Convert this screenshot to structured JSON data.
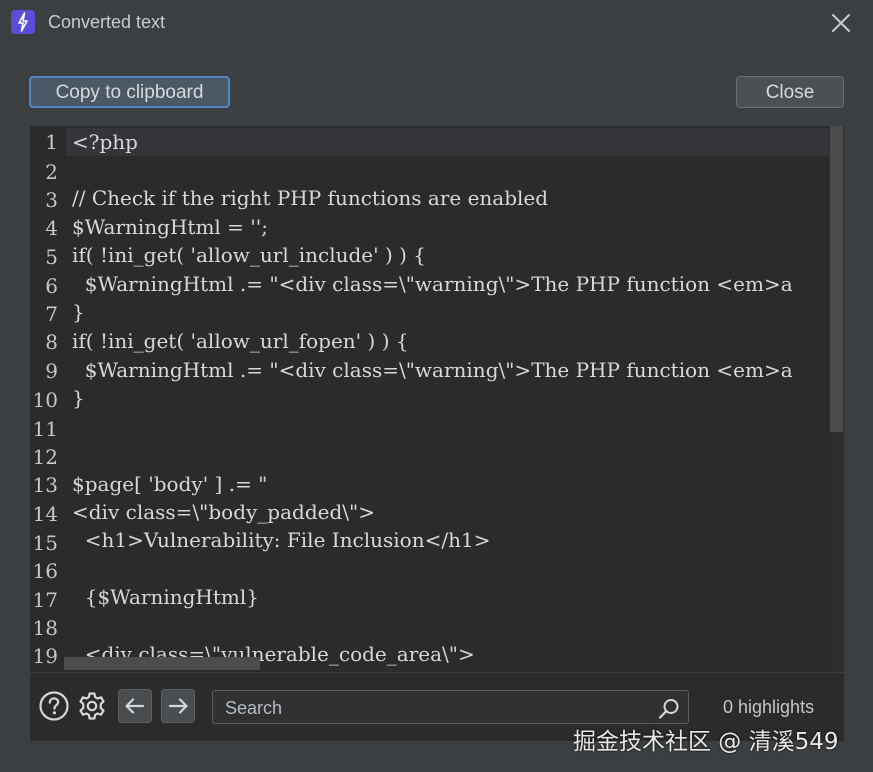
{
  "window": {
    "title": "Converted text",
    "app_icon": "lightning-icon",
    "accent": "#5a4dd6"
  },
  "toolbar": {
    "copy_label": "Copy to clipboard",
    "close_label": "Close"
  },
  "editor": {
    "line_numbers": [
      "1",
      "2",
      "3",
      "4",
      "5",
      "6",
      "7",
      "8",
      "9",
      "10",
      "11",
      "12",
      "13",
      "14",
      "15",
      "16",
      "17",
      "18",
      "19"
    ],
    "lines": [
      "<?php",
      "",
      "// Check if the right PHP functions are enabled",
      "$WarningHtml = '';",
      "if( !ini_get( 'allow_url_include' ) ) {",
      "  $WarningHtml .= \"<div class=\\\"warning\\\">The PHP function <em>a",
      "}",
      "if( !ini_get( 'allow_url_fopen' ) ) {",
      "  $WarningHtml .= \"<div class=\\\"warning\\\">The PHP function <em>a",
      "}",
      "",
      "",
      "$page[ 'body' ] .= \"",
      "<div class=\\\"body_padded\\\">",
      "  <h1>Vulnerability: File Inclusion</h1>",
      "",
      "  {$WarningHtml}",
      "",
      "  <div class=\\\"vulnerable_code_area\\\">"
    ]
  },
  "bottombar": {
    "help_icon": "help-icon",
    "settings_icon": "gear-icon",
    "prev_icon": "arrow-left-icon",
    "next_icon": "arrow-right-icon",
    "search_placeholder": "Search",
    "search_value": "",
    "highlights_text": "0 highlights"
  },
  "watermark": "掘金技术社区 @ 清溪549"
}
